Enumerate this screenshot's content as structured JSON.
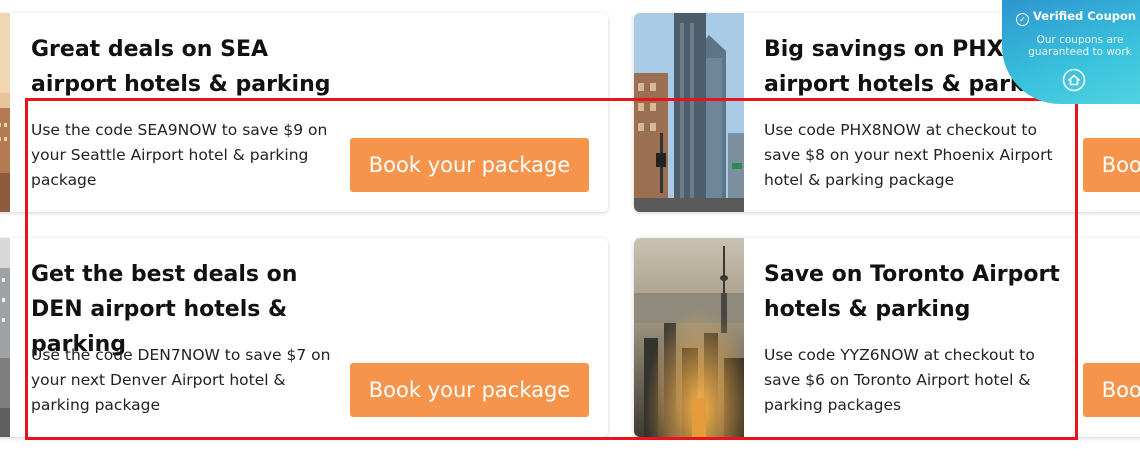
{
  "cards": [
    {
      "title": "Great deals on SEA airport hotels & parking",
      "description": "Use the code SEA9NOW to save $9 on your Seattle Airport hotel & parking package",
      "button_label": "Book your package"
    },
    {
      "title": "Big savings on PHX airport hotels & parking",
      "description": "Use code PHX8NOW at checkout to save $8 on your next Phoenix Airport hotel & parking package",
      "button_label": "Book your package"
    },
    {
      "title": "Get the best deals on DEN airport hotels & parking",
      "description": "Use the code DEN7NOW to save $7 on your next Denver Airport hotel & parking package",
      "button_label": "Book your package"
    },
    {
      "title": "Save on Toronto Airport hotels & parking",
      "description": "Use code YYZ6NOW at checkout to save $6 on Toronto Airport hotel & parking packages",
      "button_label": "Book your package"
    }
  ],
  "verified_badge": {
    "title": "Verified Coupon",
    "subtitle": "Our coupons are guaranteed to work"
  },
  "colors": {
    "button": "#f5944a",
    "highlight": "#e8141b",
    "badge": "#2d95cf"
  }
}
